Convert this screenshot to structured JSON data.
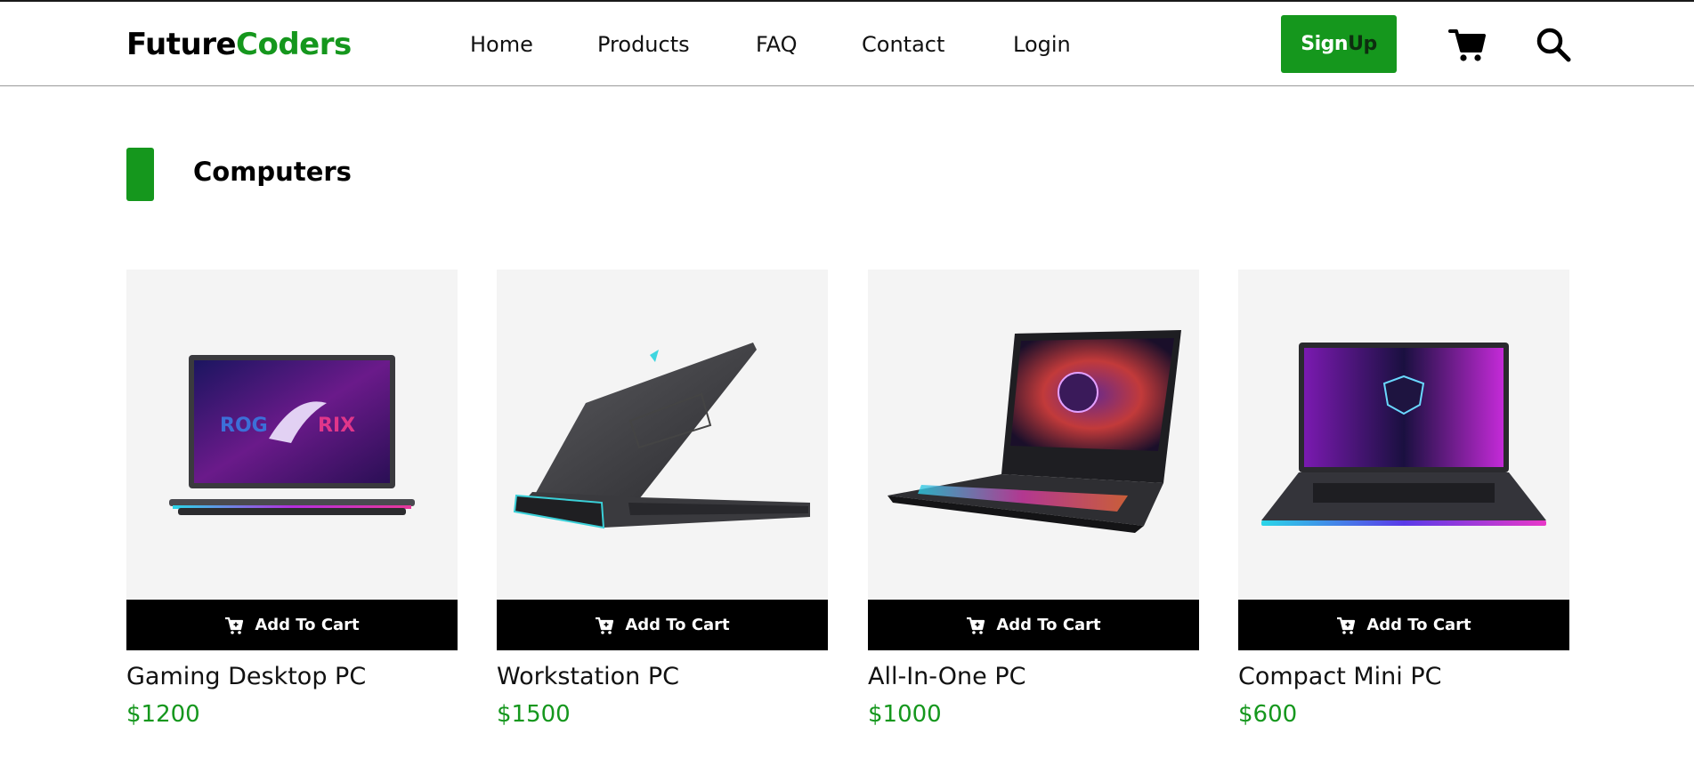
{
  "brand": {
    "part1": "Future",
    "part2": "Coders",
    "accent_color": "#15971d"
  },
  "nav": {
    "items": [
      "Home",
      "Products",
      "FAQ",
      "Contact",
      "Login"
    ]
  },
  "header_actions": {
    "signup_part1": "Sign",
    "signup_part2": "Up",
    "cart_icon": "cart-icon",
    "search_icon": "search-icon"
  },
  "section": {
    "title": "Computers"
  },
  "products": [
    {
      "name": "Gaming Desktop PC",
      "price": "$1200",
      "button_label": "Add To Cart",
      "image": "laptop-front-rog"
    },
    {
      "name": "Workstation PC",
      "price": "$1500",
      "button_label": "Add To Cart",
      "image": "laptop-rear-alienware"
    },
    {
      "name": "All-In-One PC",
      "price": "$1000",
      "button_label": "Add To Cart",
      "image": "laptop-angle-msi"
    },
    {
      "name": "Compact Mini PC",
      "price": "$600",
      "button_label": "Add To Cart",
      "image": "laptop-front-msi"
    }
  ]
}
